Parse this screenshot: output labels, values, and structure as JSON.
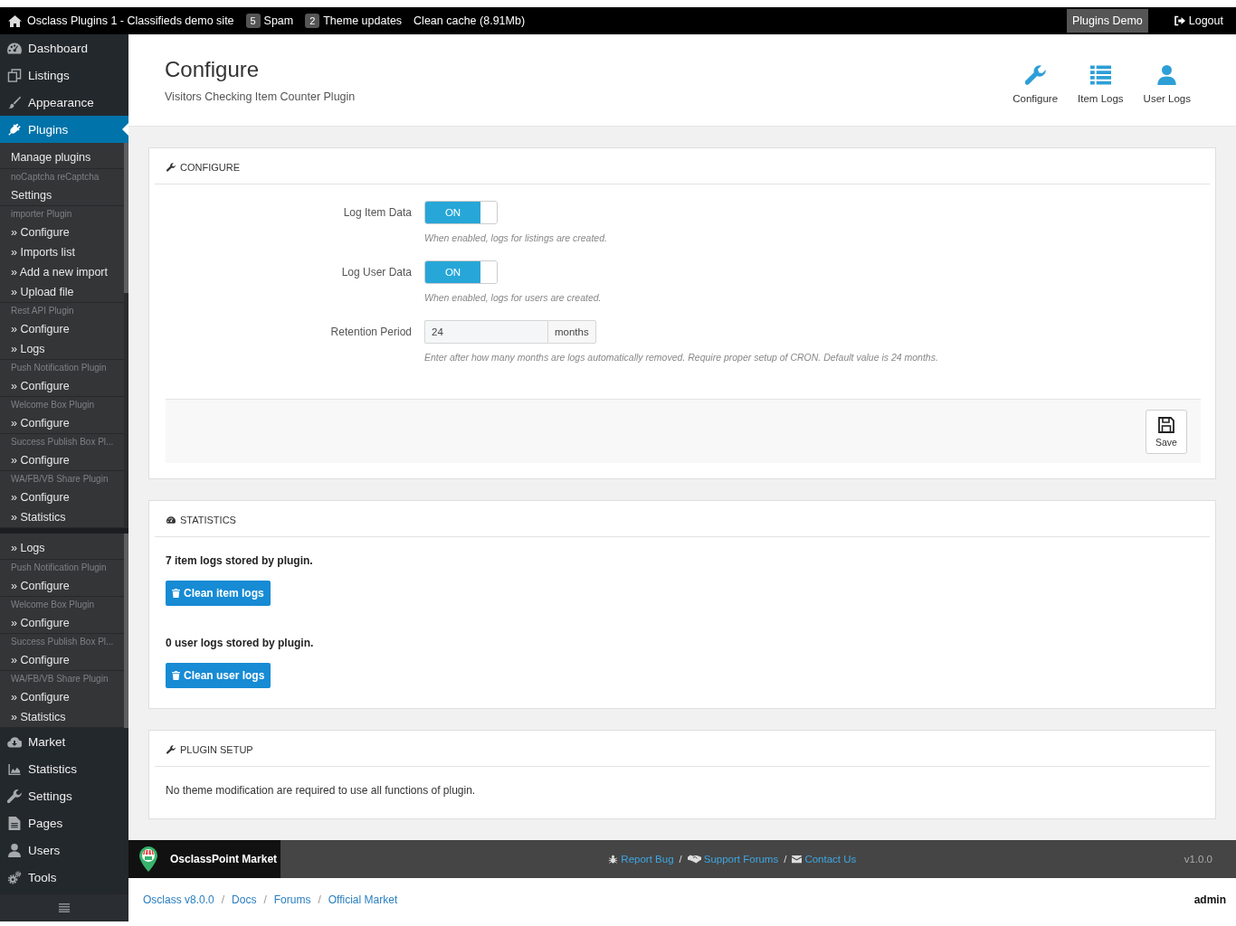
{
  "top_bar": {
    "site_title": "Osclass Plugins 1 - Classifieds demo site",
    "badges": [
      {
        "count": "5",
        "label": "Spam"
      },
      {
        "count": "2",
        "label": "Theme updates"
      }
    ],
    "clean_cache": "Clean cache (8.91Mb)",
    "demo_button": "Plugins Demo",
    "logout": "Logout"
  },
  "sidebar": {
    "menu": [
      {
        "label": "Dashboard",
        "selected": false
      },
      {
        "label": "Listings",
        "selected": false
      },
      {
        "label": "Appearance",
        "selected": false
      },
      {
        "label": "Plugins",
        "selected": true,
        "submenu": [
          {
            "links": [
              "Manage plugins"
            ]
          },
          {
            "heading": "noCaptcha reCaptcha",
            "links": [
              "Settings"
            ]
          },
          {
            "heading": "importer Plugin",
            "links": [
              "» Configure",
              "» Imports list",
              "» Add a new import",
              "» Upload file"
            ]
          },
          {
            "heading": "Rest API Plugin",
            "links": [
              "» Configure",
              "» Logs"
            ]
          },
          {
            "heading": "Push Notification Plugin",
            "links": [
              "» Configure"
            ]
          },
          {
            "heading": "Welcome Box Plugin",
            "links": [
              "» Configure"
            ]
          },
          {
            "heading": "Success Publish Box Pl...",
            "links": [
              "» Configure"
            ]
          },
          {
            "heading": "WA/FB/VB Share Plugin",
            "links": [
              "» Configure",
              "» Statistics"
            ]
          }
        ],
        "submenu_continued": [
          {
            "links": [
              "» Logs"
            ]
          },
          {
            "heading": "Push Notification Plugin",
            "links": [
              "» Configure"
            ]
          },
          {
            "heading": "Welcome Box Plugin",
            "links": [
              "» Configure"
            ]
          },
          {
            "heading": "Success Publish Box Pl...",
            "links": [
              "» Configure"
            ]
          },
          {
            "heading": "WA/FB/VB Share Plugin",
            "links": [
              "» Configure",
              "» Statistics"
            ]
          }
        ]
      },
      {
        "label": "Market",
        "selected": false
      },
      {
        "label": "Statistics",
        "selected": false
      },
      {
        "label": "Settings",
        "selected": false
      },
      {
        "label": "Pages",
        "selected": false
      },
      {
        "label": "Users",
        "selected": false
      },
      {
        "label": "Tools",
        "selected": false
      }
    ]
  },
  "header": {
    "title": "Configure",
    "subtitle": "Visitors Checking Item Counter Plugin",
    "nav": [
      "Configure",
      "Item Logs",
      "User Logs"
    ]
  },
  "configure_panel": {
    "heading": "CONFIGURE",
    "fields": [
      {
        "kind": "toggle",
        "label": "Log Item Data",
        "on": true,
        "state_label": "ON",
        "hint": "When enabled, logs for listings are created."
      },
      {
        "kind": "toggle",
        "label": "Log User Data",
        "on": true,
        "state_label": "ON",
        "hint": "When enabled, logs for users are created."
      },
      {
        "kind": "number",
        "label": "Retention Period",
        "value": "24",
        "unit": "months",
        "hint": "Enter after how many months are logs automatically removed. Require proper setup of CRON. Default value is 24 months."
      }
    ],
    "save_button": "Save"
  },
  "statistics_panel": {
    "heading": "STATISTICS",
    "entries": [
      {
        "summary": "7 item logs stored by plugin.",
        "button": "Clean item logs"
      },
      {
        "summary": "0 user logs stored by plugin.",
        "button": "Clean user logs"
      }
    ]
  },
  "plugin_setup_panel": {
    "heading": "PLUGIN SETUP",
    "text": "No theme modification are required to use all functions of plugin."
  },
  "footer": {
    "brand": "OsclassPoint Market",
    "links": [
      "Report Bug",
      "Support Forums",
      "Contact Us"
    ],
    "separators": [
      "/",
      "/"
    ],
    "version": "v1.0.0"
  },
  "breadcrumbs": {
    "links": [
      "Osclass v8.0.0",
      "Docs",
      "Forums",
      "Official Market"
    ],
    "separators": [
      "/",
      "/",
      "/"
    ],
    "user": "admin"
  }
}
